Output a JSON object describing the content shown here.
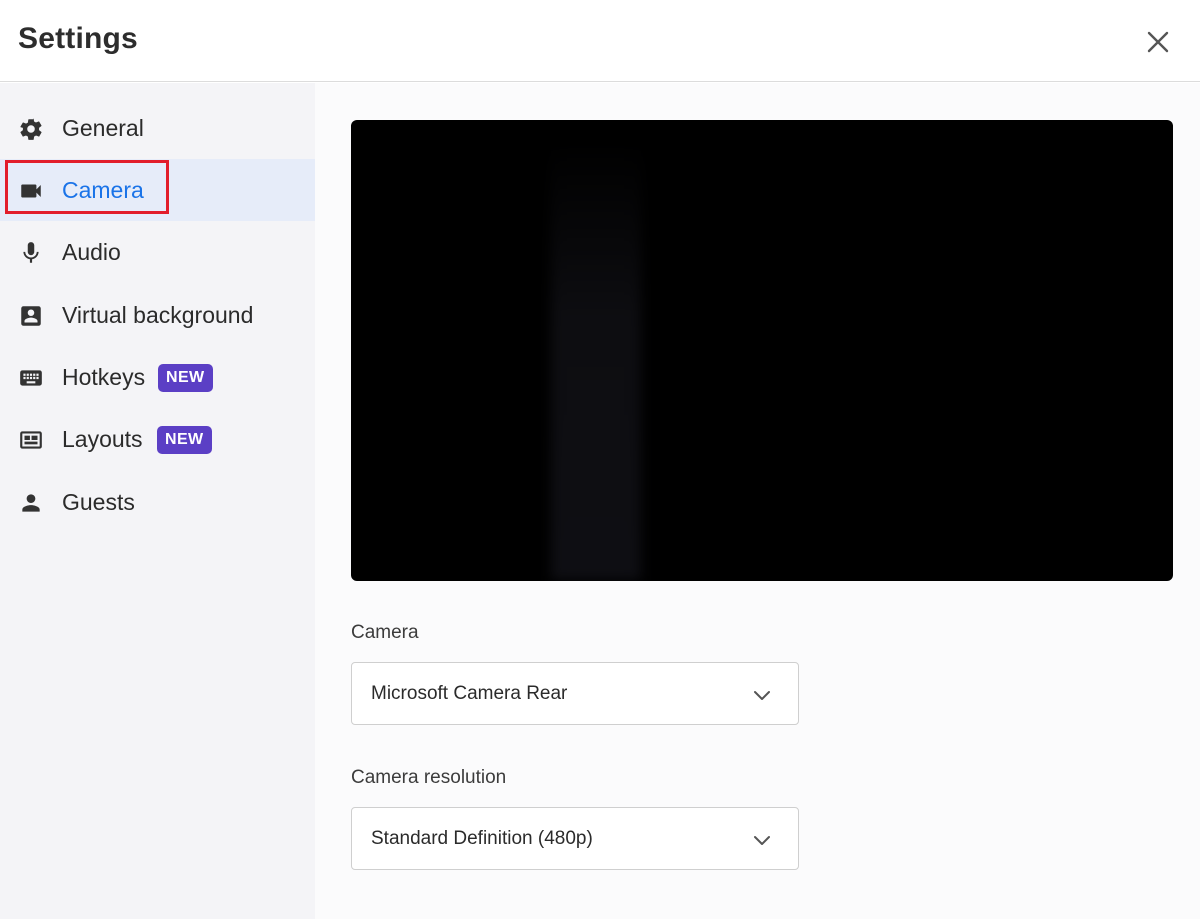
{
  "header": {
    "title": "Settings",
    "close_icon": "close-icon"
  },
  "sidebar": {
    "items": [
      {
        "label": "General",
        "icon": "gear-icon",
        "active": false
      },
      {
        "label": "Camera",
        "icon": "video-camera-icon",
        "active": true
      },
      {
        "label": "Audio",
        "icon": "microphone-icon",
        "active": false
      },
      {
        "label": "Virtual background",
        "icon": "portrait-icon",
        "active": false
      },
      {
        "label": "Hotkeys",
        "icon": "keyboard-icon",
        "active": false,
        "badge": "NEW"
      },
      {
        "label": "Layouts",
        "icon": "layout-icon",
        "active": false,
        "badge": "NEW"
      },
      {
        "label": "Guests",
        "icon": "person-icon",
        "active": false
      }
    ]
  },
  "main": {
    "camera": {
      "label": "Camera",
      "value": "Microsoft Camera Rear"
    },
    "resolution": {
      "label": "Camera resolution",
      "value": "Standard Definition (480p)"
    }
  },
  "colors": {
    "accent": "#1a73e8",
    "badge": "#5b3fc5",
    "highlight": "#e21d2b",
    "sidebar_bg": "#f4f4f7",
    "active_bg": "#e6ecf9"
  }
}
